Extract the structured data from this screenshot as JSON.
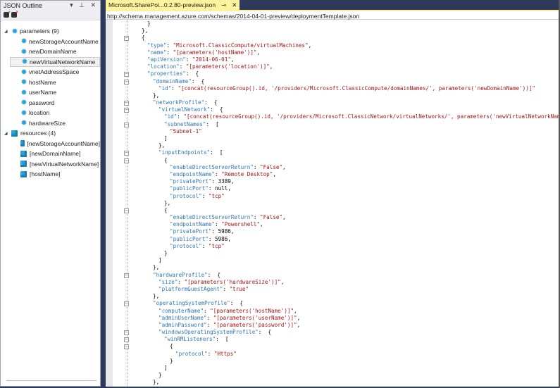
{
  "outline": {
    "title": "JSON Outline",
    "controls": "▾ ⊥ ✕",
    "toolbar": [
      {
        "icon": "add-node-icon"
      },
      {
        "icon": "remove-node-icon"
      }
    ],
    "groups": [
      {
        "label": "parameters (9)",
        "icon": "gear-icon",
        "children": [
          "newStorageAccountName",
          "newDomainName",
          "newVirtualNetworkName",
          "vnetAddressSpace",
          "hostName",
          "userName",
          "password",
          "location",
          "hardwareSize"
        ],
        "selected": "newVirtualNetworkName"
      },
      {
        "label": "resources (4)",
        "icon": "cube-icon",
        "children": [
          "[newStorageAccountName]",
          "[newDomainName]",
          "[newVirtualNetworkName]",
          "[hostName]"
        ]
      }
    ]
  },
  "editor": {
    "tab_label": "Microsoft.SharePoi...0.2.80-preview.json",
    "tab_pin": "⊸",
    "tab_close": "✕",
    "schema_url": "http://schema.management.azure.com/schemas/2014-04-01-preview/deploymentTemplate.json",
    "colors": {
      "key": "#2e75b6",
      "string": "#a31515",
      "tab": "#fff29d"
    },
    "lines": [
      {
        "i": 1,
        "p": "}"
      },
      {
        "i": 0,
        "p": "},"
      },
      {
        "i": 0,
        "p": "{",
        "f": 1
      },
      {
        "i": 1,
        "k": "\"type\"",
        "v": "\"Microsoft.ClassicCompute/virtualMachines\"",
        "p": ","
      },
      {
        "i": 1,
        "k": "\"name\"",
        "v": "\"[parameters('hostName')]\"",
        "p": ","
      },
      {
        "i": 1,
        "k": "\"apiVersion\"",
        "v": "\"2014-06-01\"",
        "p": ","
      },
      {
        "i": 1,
        "k": "\"location\"",
        "v": "\"[parameters('location')]\"",
        "p": ","
      },
      {
        "i": 1,
        "k": "\"properties\"",
        "p": " {",
        "f": 1
      },
      {
        "i": 2,
        "k": "\"domainName\"",
        "p": " {",
        "f": 1
      },
      {
        "i": 3,
        "k": "\"id\"",
        "v": "\"[concat(resourceGroup().id, '/providers/Microsoft.ClassicCompute/domainNames/', parameters('newDomainName'))]\""
      },
      {
        "i": 2,
        "p": "},"
      },
      {
        "i": 2,
        "k": "\"networkProfile\"",
        "p": " {",
        "f": 1
      },
      {
        "i": 3,
        "k": "\"virtualNetwork\"",
        "p": " {",
        "f": 1
      },
      {
        "i": 4,
        "k": "\"id\"",
        "v": "\"[concat(resourceGroup().id, '/providers/Microsoft.ClassicNetwork/virtualNetworks/', parameters('newVirtualNetworkName'))]\"",
        "p": ","
      },
      {
        "i": 4,
        "k": "\"subnetNames\"",
        "p": " [",
        "f": 1
      },
      {
        "i": 5,
        "v": "\"Subnet-1\""
      },
      {
        "i": 4,
        "p": "]"
      },
      {
        "i": 3,
        "p": "},"
      },
      {
        "i": 3,
        "k": "\"inputEndpoints\"",
        "p": " [",
        "f": 1
      },
      {
        "i": 4,
        "p": "{",
        "f": 1
      },
      {
        "i": 5,
        "k": "\"enableDirectServerReturn\"",
        "v": "\"False\"",
        "p": ","
      },
      {
        "i": 5,
        "k": "\"endpointName\"",
        "v": "\"Remote Desktop\"",
        "p": ","
      },
      {
        "i": 5,
        "k": "\"privatePort\"",
        "n": "3389",
        "p": ","
      },
      {
        "i": 5,
        "k": "\"publicPort\"",
        "n": "null",
        "p": ","
      },
      {
        "i": 5,
        "k": "\"protocol\"",
        "v": "\"tcp\""
      },
      {
        "i": 4,
        "p": "},"
      },
      {
        "i": 4,
        "p": "{",
        "f": 1
      },
      {
        "i": 5,
        "k": "\"enableDirectServerReturn\"",
        "v": "\"False\"",
        "p": ","
      },
      {
        "i": 5,
        "k": "\"endpointName\"",
        "v": "\"Powershell\"",
        "p": ","
      },
      {
        "i": 5,
        "k": "\"privatePort\"",
        "n": "5986",
        "p": ","
      },
      {
        "i": 5,
        "k": "\"publicPort\"",
        "n": "5986",
        "p": ","
      },
      {
        "i": 5,
        "k": "\"protocol\"",
        "v": "\"tcp\""
      },
      {
        "i": 4,
        "p": "}"
      },
      {
        "i": 3,
        "p": "]"
      },
      {
        "i": 2,
        "p": "},"
      },
      {
        "i": 2,
        "k": "\"hardwareProfile\"",
        "p": " {",
        "f": 1
      },
      {
        "i": 3,
        "k": "\"size\"",
        "v": "\"[parameters('hardwareSize')]\"",
        "p": ","
      },
      {
        "i": 3,
        "k": "\"platformGuestAgent\"",
        "v": "\"true\""
      },
      {
        "i": 2,
        "p": "},"
      },
      {
        "i": 2,
        "k": "\"operatingSystemProfile\"",
        "p": " {",
        "f": 1
      },
      {
        "i": 3,
        "k": "\"computerName\"",
        "v": "\"[parameters('hostName')]\"",
        "p": ","
      },
      {
        "i": 3,
        "k": "\"adminUserName\"",
        "v": "\"[parameters('userName')]\"",
        "p": ","
      },
      {
        "i": 3,
        "k": "\"adminPassword\"",
        "v": "\"[parameters('password')]\"",
        "p": ","
      },
      {
        "i": 3,
        "k": "\"windowsOperatingSystemProfile\"",
        "p": " {",
        "f": 1
      },
      {
        "i": 4,
        "k": "\"winRMListeners\"",
        "p": " [",
        "f": 1
      },
      {
        "i": 5,
        "p": "{",
        "f": 1
      },
      {
        "i": 6,
        "k": "\"protocol\"",
        "v": "\"Https\""
      },
      {
        "i": 5,
        "p": "}"
      },
      {
        "i": 4,
        "p": "]"
      },
      {
        "i": 3,
        "p": "}"
      },
      {
        "i": 2,
        "p": "},"
      }
    ]
  }
}
